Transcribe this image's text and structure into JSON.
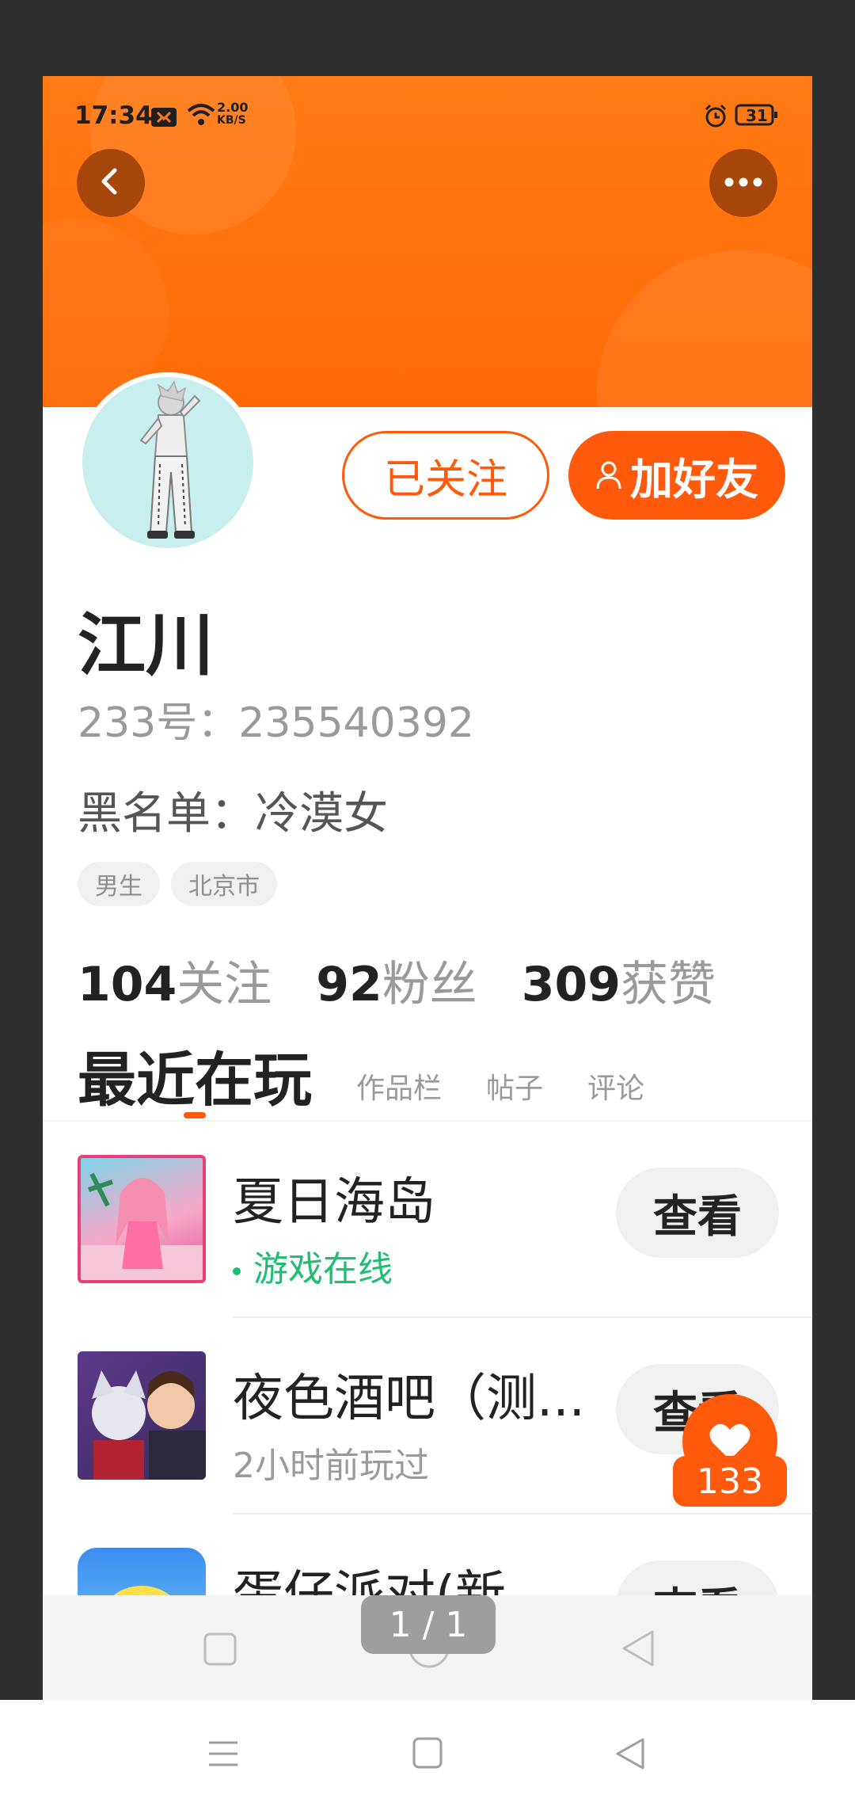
{
  "status_bar": {
    "time": "17:34",
    "net_speed_value": "2.00",
    "net_speed_unit": "KB/S",
    "battery": "31"
  },
  "header": {
    "back_icon": "chevron-left-icon",
    "more_icon": "more-dots-icon"
  },
  "profile": {
    "name": "江川",
    "id_text": "233号：235540392",
    "blacklist_text": "黑名单：冷漠女",
    "tags": [
      "男生",
      "北京市"
    ],
    "followed_label": "已关注",
    "add_friend_label": "加好友"
  },
  "stats": [
    {
      "num": "104",
      "label": "关注"
    },
    {
      "num": "92",
      "label": "粉丝"
    },
    {
      "num": "309",
      "label": "获赞"
    }
  ],
  "tabs": {
    "active": "最近在玩",
    "others": [
      "作品栏",
      "帖子",
      "评论"
    ]
  },
  "games": [
    {
      "title": "夏日海岛",
      "subtitle": "游戏在线",
      "status": "online",
      "action": "查看"
    },
    {
      "title": "夜色酒吧（测...",
      "subtitle": "2小时前玩过",
      "status": "played",
      "action": "查看"
    },
    {
      "title": "蛋仔派对(新",
      "subtitle": "",
      "status": "played",
      "action": "查看"
    }
  ],
  "like_badge": {
    "count": "133"
  },
  "pager": {
    "text": "1 / 1"
  },
  "colors": {
    "accent": "#ff5a0c",
    "online": "#1fbf73",
    "banner": "#ff7a14"
  }
}
